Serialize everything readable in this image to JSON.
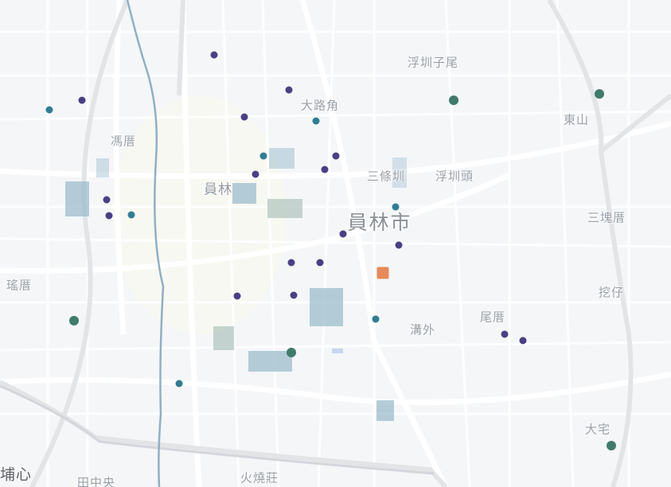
{
  "map": {
    "labels": [
      {
        "id": "fubaiziwei",
        "text": "浮圳子尾",
        "size": "normal"
      },
      {
        "id": "dalujiao",
        "text": "大路角",
        "size": "normal"
      },
      {
        "id": "pingcuo",
        "text": "馮厝",
        "size": "normal"
      },
      {
        "id": "dongshan",
        "text": "東山",
        "size": "normal"
      },
      {
        "id": "yuanlin-small",
        "text": "員林",
        "size": "mid"
      },
      {
        "id": "santiaowei",
        "text": "三條圳",
        "size": "normal"
      },
      {
        "id": "fubaitou",
        "text": "浮圳頭",
        "size": "normal"
      },
      {
        "id": "yuanlin-city",
        "text": "員林市",
        "size": "big"
      },
      {
        "id": "sankuaicuo",
        "text": "三塊厝",
        "size": "normal"
      },
      {
        "id": "yaocuo",
        "text": "瑤厝",
        "size": "normal"
      },
      {
        "id": "wazai",
        "text": "挖仔",
        "size": "normal"
      },
      {
        "id": "weicuo",
        "text": "尾厝",
        "size": "normal"
      },
      {
        "id": "gouwai",
        "text": "溝外",
        "size": "normal"
      },
      {
        "id": "dazhai",
        "text": "大宅",
        "size": "normal"
      },
      {
        "id": "puxin",
        "text": "埔心",
        "size": "dark"
      },
      {
        "id": "tianzhongyang",
        "text": "田中央",
        "size": "normal"
      },
      {
        "id": "huoshaozhuang",
        "text": "火燒莊",
        "size": "normal"
      }
    ],
    "marker_colors": {
      "purple": "#4a3f86",
      "teal": "#2f7d95",
      "green": "#3f7b6b",
      "orange": "#e8895a"
    }
  }
}
